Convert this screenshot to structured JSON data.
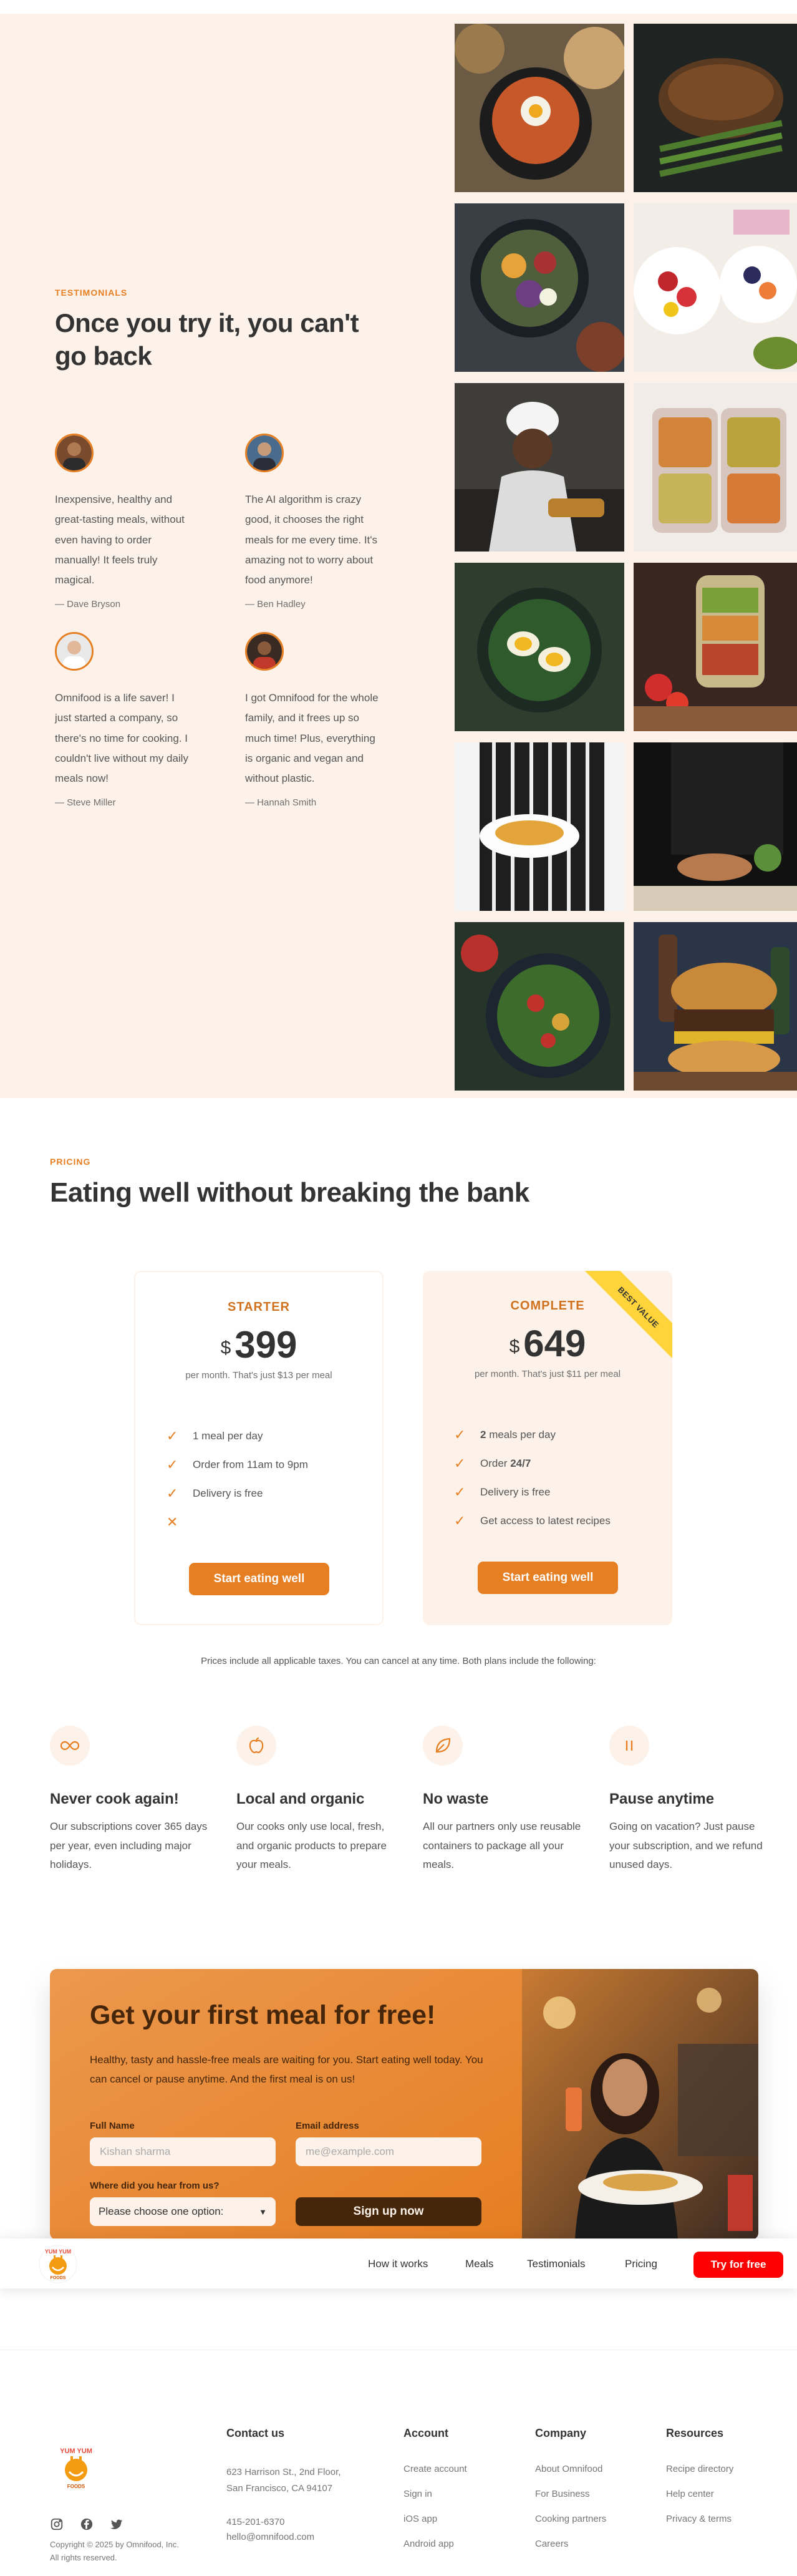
{
  "testimonials": {
    "subheading": "Testimonials",
    "heading_line1": "Once you try it, you can't",
    "heading_line2": "go back",
    "items": [
      {
        "quote": "Inexpensive, healthy and great-tasting meals, without even having to order manually! It feels truly magical.",
        "name": "— Dave Bryson"
      },
      {
        "quote": "The AI algorithm is crazy good, it chooses the right meals for me every time. It's amazing not to worry about food anymore!",
        "name": "— Ben Hadley"
      },
      {
        "quote": "Omnifood is a life saver! I just started a company, so there's no time for cooking. I couldn't live without my daily meals now!",
        "name": "— Steve Miller"
      },
      {
        "quote": "I got Omnifood for the whole family, and it frees up so much time! Plus, everything is organic and vegan and without plastic.",
        "name": "— Hannah Smith"
      }
    ]
  },
  "pricing": {
    "subheading": "Pricing",
    "heading": "Eating well without breaking the bank",
    "plans": [
      {
        "name": "STARTER",
        "currency": "$",
        "price": "399",
        "sub": "per month. That's just $13 per meal",
        "features": [
          "1 meal per day",
          "Order from 11am to 9pm",
          "Delivery is free",
          ""
        ],
        "button": "Start eating well"
      },
      {
        "name": "COMPLETE",
        "currency": "$",
        "price": "649",
        "sub": "per month. That's just $11 per meal",
        "features_bold": [
          "2",
          "24/7",
          "",
          ""
        ],
        "features_rest": [
          " meals per day",
          "Order ",
          "Delivery is free",
          "Get access to latest recipes"
        ],
        "button": "Start eating well",
        "ribbon": "BEST VALUE"
      }
    ],
    "note": "Prices include all applicable taxes. You can cancel at any time. Both plans include the following:"
  },
  "features": [
    {
      "icon": "infinity-icon",
      "title": "Never cook again!",
      "text": "Our subscriptions cover 365 days per year, even including major holidays."
    },
    {
      "icon": "apple-icon",
      "title": "Local and organic",
      "text": "Our cooks only use local, fresh, and organic products to prepare your meals."
    },
    {
      "icon": "leaf-icon",
      "title": "No waste",
      "text": "All our partners only use reusable containers to package all your meals."
    },
    {
      "icon": "pause-icon",
      "title": "Pause anytime",
      "text": "Going on vacation? Just pause your subscription, and we refund unused days."
    }
  ],
  "cta": {
    "heading": "Get your first meal for free!",
    "text": "Healthy, tasty and hassle-free meals are waiting for you. Start eating well today. You can cancel or pause anytime. And the first meal is on us!",
    "full_name_label": "Full Name",
    "full_name_placeholder": "Kishan sharma",
    "email_label": "Email address",
    "email_placeholder": "me@example.com",
    "source_label": "Where did you hear from us?",
    "source_selected": "Please choose one option:",
    "submit": "Sign up now"
  },
  "nav": {
    "logo_text": "YUM YUM",
    "logo_sub": "FOODS",
    "links": [
      "How it works",
      "Meals",
      "Testimonials",
      "Pricing"
    ],
    "cta": "Try for free"
  },
  "footer": {
    "logo_text": "YUM YUM",
    "logo_sub": "FOODS",
    "copyright": "Copyright © 2025 by Omnifood, Inc. All rights reserved.",
    "contact": {
      "heading": "Contact us",
      "address_line1": "623 Harrison St., 2nd Floor,",
      "address_line2": "San Francisco, CA 94107",
      "phone": "415-201-6370",
      "email": "hello@omnifood.com"
    },
    "columns": [
      {
        "heading": "Account",
        "links": [
          "Create account",
          "Sign in",
          "iOS app",
          "Android app"
        ]
      },
      {
        "heading": "Company",
        "links": [
          "About Omnifood",
          "For Business",
          "Cooking partners",
          "Careers"
        ]
      },
      {
        "heading": "Resources",
        "links": [
          "Recipe directory",
          "Help center",
          "Privacy & terms"
        ]
      }
    ]
  },
  "colors": {
    "primary": "#e67e22",
    "tint": "#fdf2e9",
    "shade": "#45260a",
    "nav_cta": "#ff0000"
  }
}
